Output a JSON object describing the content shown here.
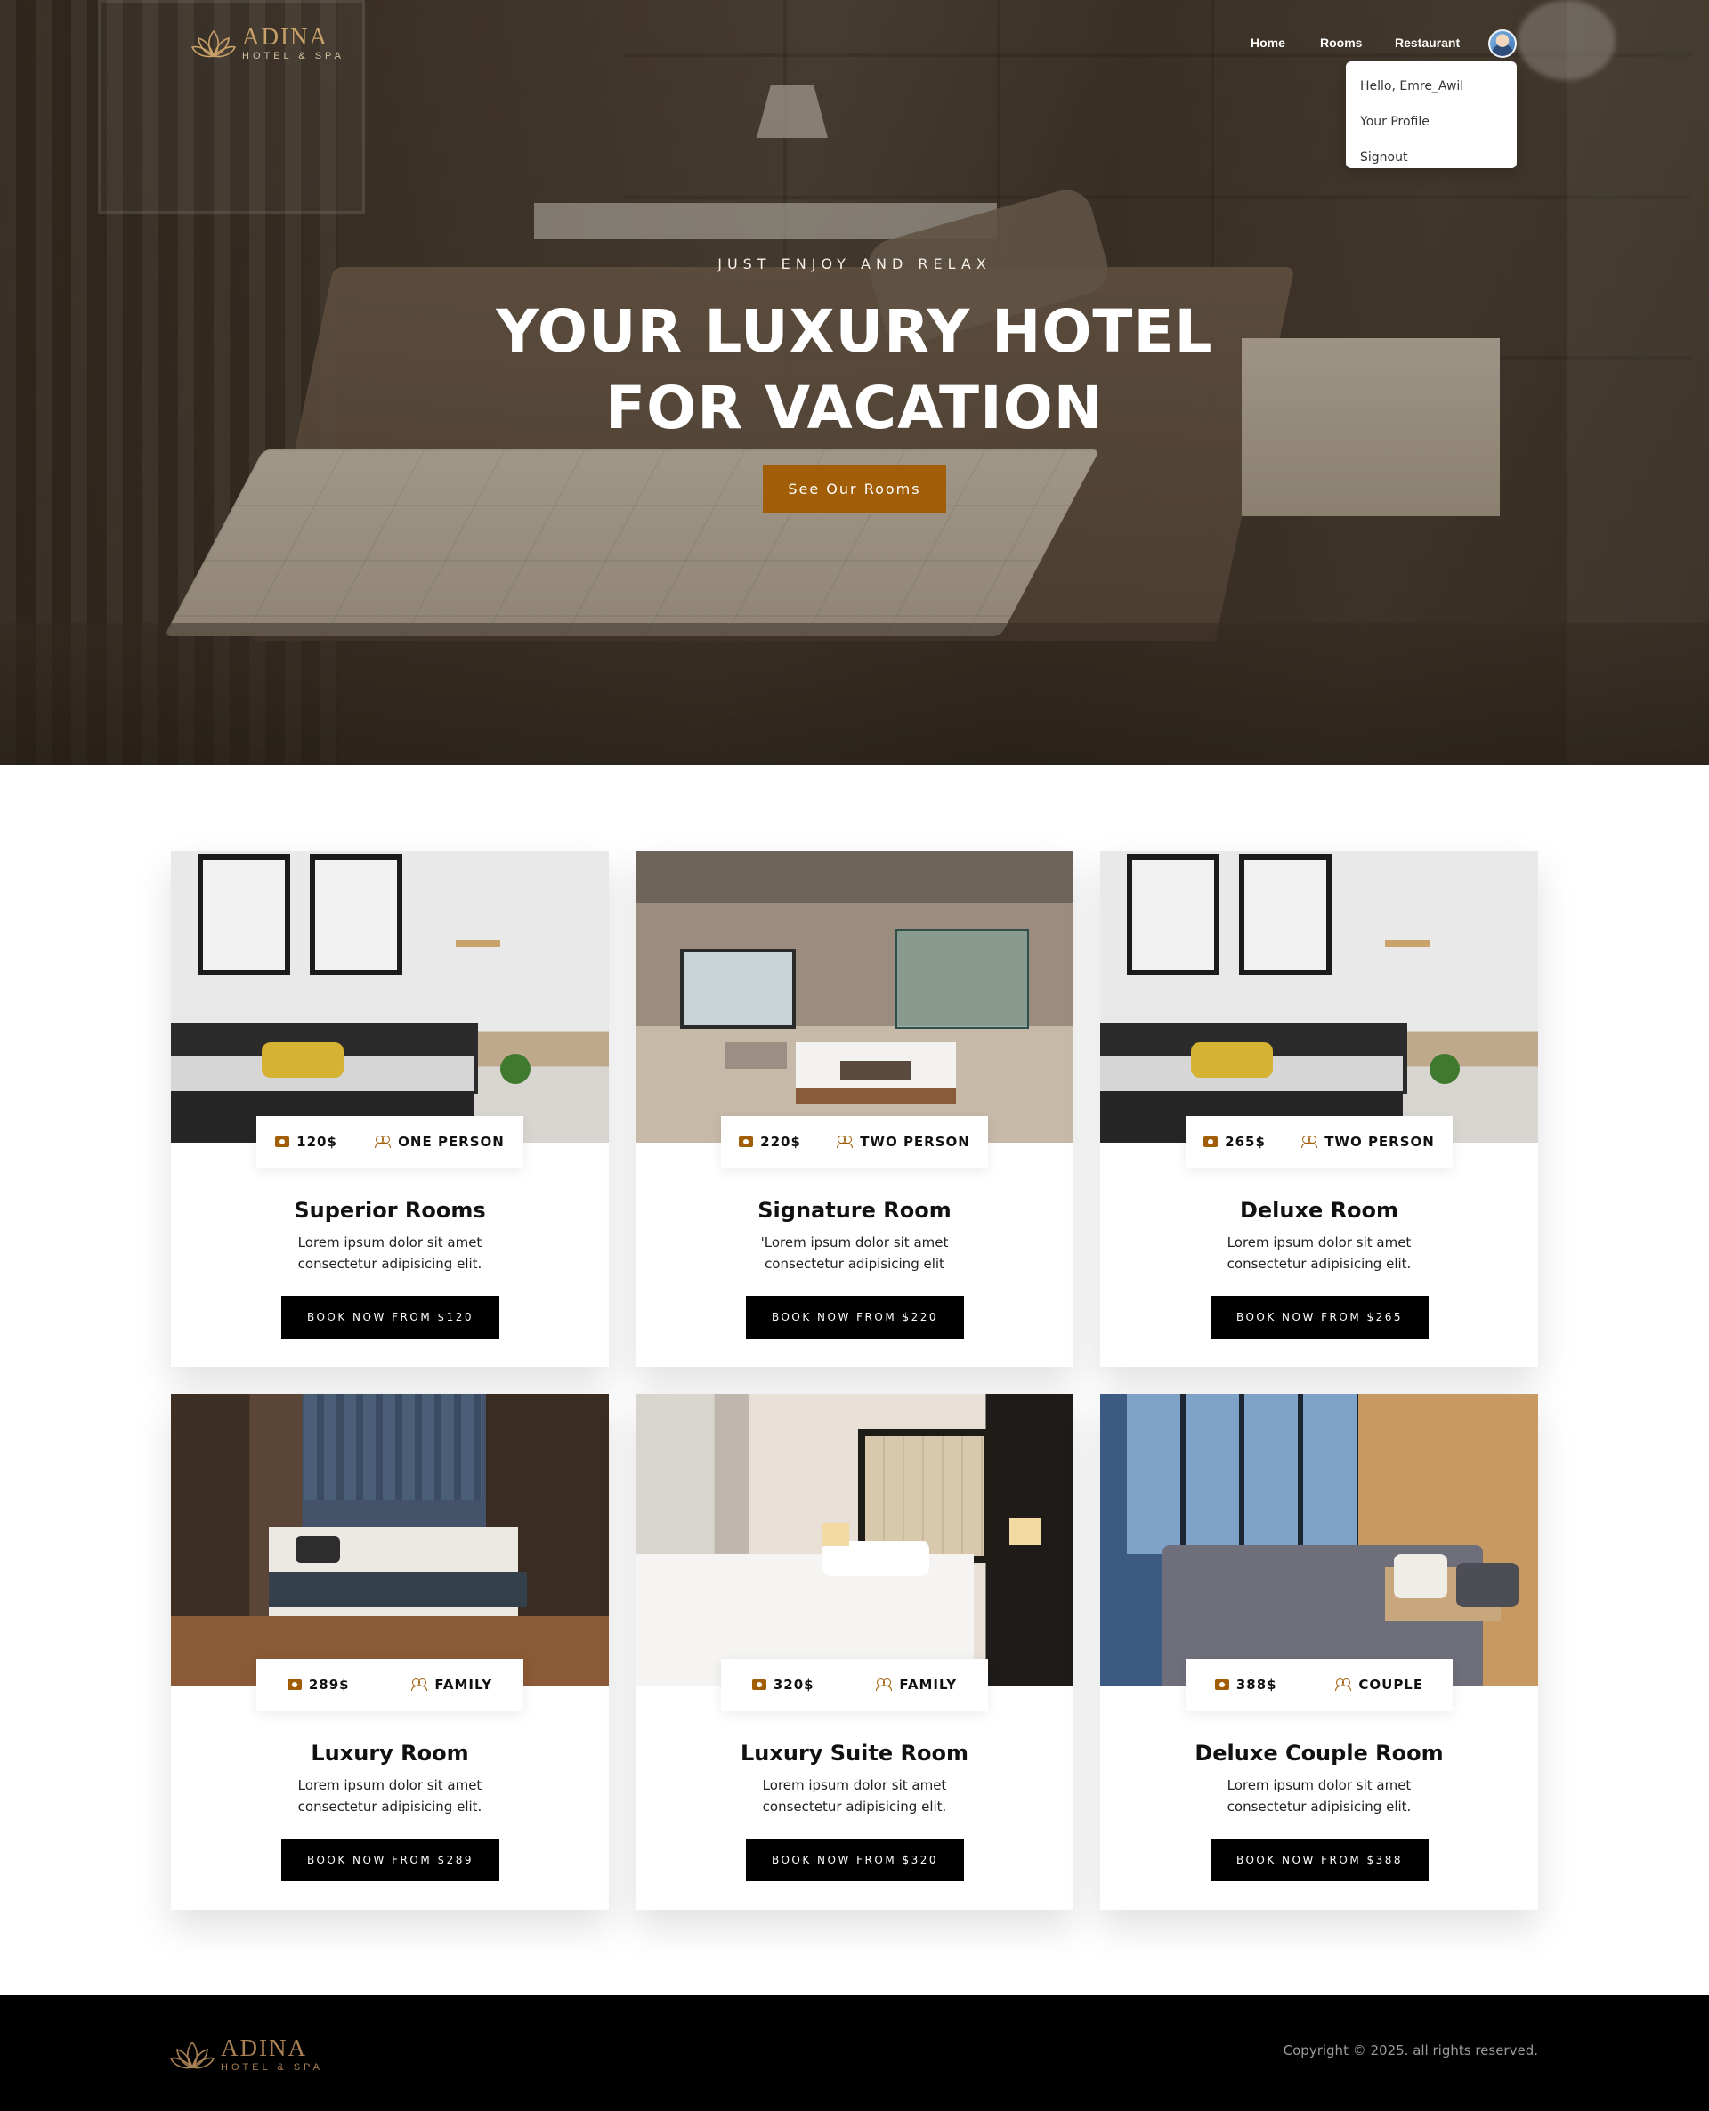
{
  "brand": {
    "name": "ADINA",
    "tagline": "HOTEL & SPA",
    "accent": "#a15e07"
  },
  "nav": {
    "home": "Home",
    "rooms": "Rooms",
    "restaurant": "Restaurant"
  },
  "user_menu": {
    "greeting": "Hello, Emre_Awil",
    "profile": "Your Profile",
    "signout": "Signout"
  },
  "hero": {
    "kicker": "JUST ENJOY AND RELAX",
    "title_line1": "YOUR LUXURY HOTEL",
    "title_line2": "FOR VACATION",
    "button": "See Our Rooms"
  },
  "rooms": [
    {
      "price": "120$",
      "capacity": "ONE PERSON",
      "title": "Superior Rooms",
      "desc": "Lorem ipsum dolor sit amet consectetur adipisicing elit.",
      "button": "BOOK NOW FROM $120"
    },
    {
      "price": "220$",
      "capacity": "TWO PERSON",
      "title": "Signature Room",
      "desc": "'Lorem ipsum dolor sit amet consectetur adipisicing elit",
      "button": "BOOK NOW FROM $220"
    },
    {
      "price": "265$",
      "capacity": "TWO PERSON",
      "title": "Deluxe Room",
      "desc": "Lorem ipsum dolor sit amet consectetur adipisicing elit.",
      "button": "BOOK NOW FROM $265"
    },
    {
      "price": "289$",
      "capacity": "FAMILY",
      "title": "Luxury Room",
      "desc": "Lorem ipsum dolor sit amet consectetur adipisicing elit.",
      "button": "BOOK NOW FROM $289"
    },
    {
      "price": "320$",
      "capacity": "FAMILY",
      "title": "Luxury Suite Room",
      "desc": "Lorem ipsum dolor sit amet consectetur adipisicing elit.",
      "button": "BOOK NOW FROM $320"
    },
    {
      "price": "388$",
      "capacity": "COUPLE",
      "title": "Deluxe Couple Room",
      "desc": "Lorem ipsum dolor sit amet consectetur adipisicing elit.",
      "button": "BOOK NOW FROM $388"
    }
  ],
  "footer": {
    "copyright": "Copyright © 2025. all rights reserved."
  }
}
